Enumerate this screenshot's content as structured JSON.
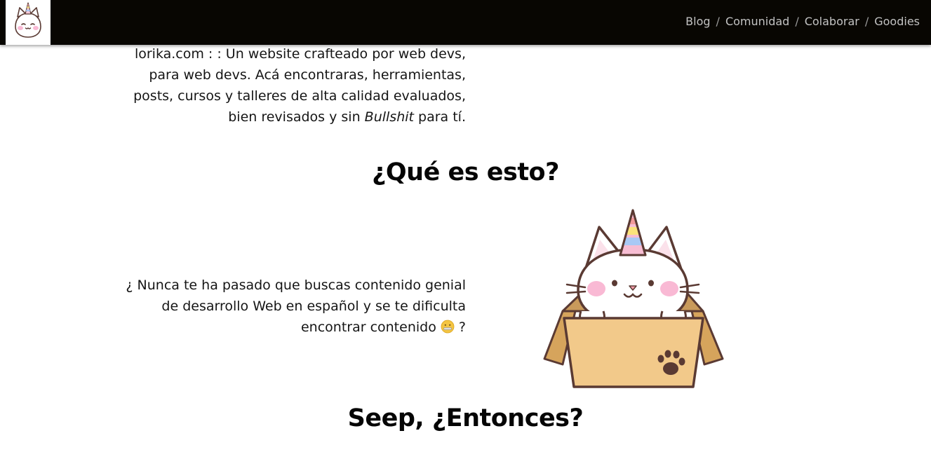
{
  "header": {
    "logo_name": "unicorn-cat-logo",
    "nav": [
      {
        "label": "Blog"
      },
      {
        "label": "Comunidad"
      },
      {
        "label": "Colaborar"
      },
      {
        "label": "Goodies"
      }
    ],
    "separator": "/"
  },
  "intro": {
    "text_before": "lorika.com : : Un website crafteado por web devs, para web devs. Acá encontraras, herramientas, posts, cursos y talleres de alta calidad evaluados, bien revisados y sin ",
    "emphasis": "Bullshit",
    "text_after": " para tí."
  },
  "section_what": {
    "title": "¿Qué es esto?",
    "question_text": "¿ Nunca te ha pasado que buscas contenido genial de desarrollo Web en español y se te dificulta encontrar contenido",
    "question_end": " ?",
    "emoji_icon": "zipper-mouth-face-icon",
    "illustration": "unicorn-cat-in-box"
  },
  "section_then": {
    "title": "Seep, ¿Entonces?"
  },
  "colors": {
    "topbar": "#080602",
    "nav_text": "#c2c2c2",
    "text": "#151515",
    "box": "#f2c98a",
    "cat_outline": "#5a3a33",
    "blush": "#f9b9d4"
  }
}
